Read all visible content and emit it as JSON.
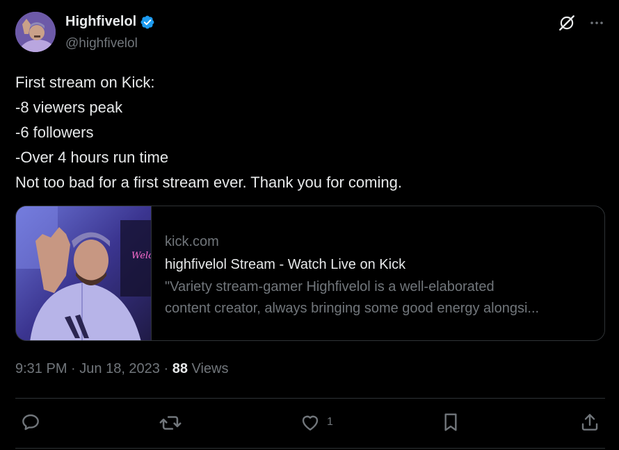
{
  "author": {
    "display_name": "Highfivelol",
    "handle": "@highfivelol",
    "verified": true
  },
  "tweet": {
    "lines": [
      "First stream on Kick:",
      "-8 viewers peak",
      "-6 followers",
      "-Over 4 hours run time",
      "Not too bad for a first stream ever. Thank you for coming."
    ]
  },
  "card": {
    "domain": "kick.com",
    "title": "highfivelol Stream - Watch Live on Kick",
    "description_lines": [
      "\"Variety stream-gamer Highfivelol is a well-elaborated",
      "content creator, always bringing some good energy alongsi..."
    ]
  },
  "meta": {
    "time": "9:31 PM",
    "separator": " · ",
    "date": "Jun 18, 2023",
    "views_count": "88",
    "views_label": " Views"
  },
  "actions": {
    "like_count": "1"
  },
  "colors": {
    "background": "#000000",
    "text_primary": "#e7e9ea",
    "text_secondary": "#71767b",
    "border": "#2f3336",
    "verified_blue": "#1d9bf0"
  },
  "icons": {
    "verified": "verified-badge-icon",
    "grok": "grok-icon",
    "more": "more-icon",
    "reply": "reply-icon",
    "repost": "repost-icon",
    "like": "heart-icon",
    "bookmark": "bookmark-icon",
    "share": "share-icon"
  }
}
